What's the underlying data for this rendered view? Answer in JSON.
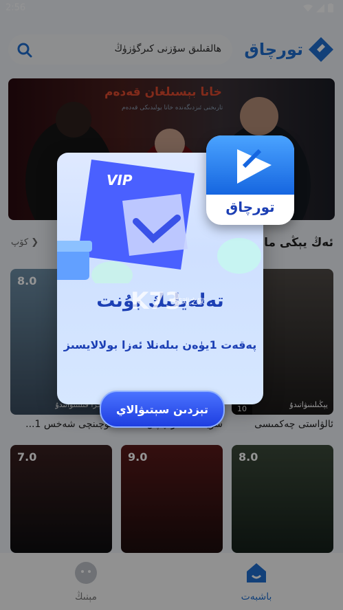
{
  "status": {
    "time": "2:56"
  },
  "header": {
    "search_placeholder": "ھالقىلىق سۆزنى كىرگۈزۈڭ",
    "logo_text": "تورچاق"
  },
  "banner": {
    "title": "خانا بېسىلغان قەدەم",
    "subtitle": "تارىخنى ئىزدىگەندە خانا يولىدىكى قەدەم"
  },
  "section": {
    "title": "ئەڭ يېڭى ما",
    "more": "كۆپ"
  },
  "cards": [
    {
      "score": "8.0",
      "tag": "ئىجرا قىلىنىۋاتىدۇ",
      "title": "ئۆچىنچى شەخس 1...",
      "episodes": ""
    },
    {
      "score": "",
      "tag": "",
      "title": "سۆيگە تىسىز چاپان",
      "episodes": ""
    },
    {
      "score": "",
      "tag": "يېڭىلىنىۋاتىدۇ",
      "title": "ئالۋاستى چەكمىسى",
      "episodes": "10"
    },
    {
      "score": "7.0",
      "tag": "",
      "title": "",
      "episodes": ""
    },
    {
      "score": "9.0",
      "tag": "",
      "title": "",
      "episodes": ""
    },
    {
      "score": "8.0",
      "tag": "",
      "title": "",
      "episodes": ""
    }
  ],
  "tabs": [
    {
      "label": "مېنىڭ"
    },
    {
      "label": "باشبەت"
    }
  ],
  "popup": {
    "vip_text": "VIP",
    "title": "تەلەيلىك بۇنت",
    "subtitle": "پەقەت 1يۈەن بىلەنلا ئەزا بولالايسىز",
    "button": "تېزدىن سېتىۋالاي",
    "app_logo_text": "تورچاق"
  },
  "watermark": {
    "main": "K73",
    "small": "游戏之家"
  },
  "colors": {
    "accent": "#1f6fd1",
    "popup_text": "#1c3fb4"
  }
}
